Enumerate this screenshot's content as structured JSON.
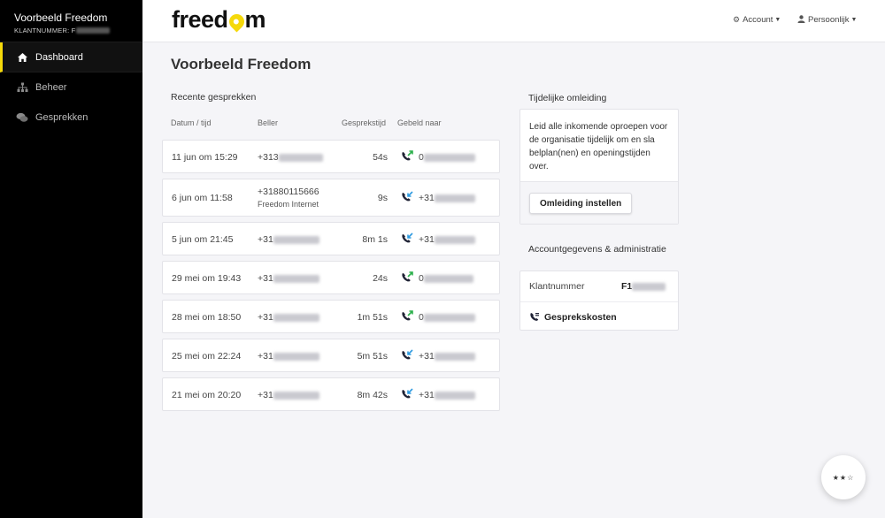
{
  "sidebar": {
    "org_name": "Voorbeeld Freedom",
    "customer_label": "KLANTNUMMER: F",
    "items": [
      {
        "label": "Dashboard",
        "icon": "home-icon",
        "active": true
      },
      {
        "label": "Beheer",
        "icon": "sitemap-icon",
        "active": false
      },
      {
        "label": "Gesprekken",
        "icon": "chat-icon",
        "active": false
      }
    ]
  },
  "header": {
    "logo_text_1": "freed",
    "logo_text_2": "m",
    "menus": [
      {
        "label": "Account",
        "icon": "gear-icon"
      },
      {
        "label": "Persoonlijk",
        "icon": "user-icon"
      }
    ]
  },
  "main": {
    "title": "Voorbeeld Freedom",
    "recent_calls": {
      "title": "Recente gesprekken",
      "columns": [
        "Datum / tijd",
        "Beller",
        "Gesprekstijd",
        "Gebeld naar"
      ],
      "rows": [
        {
          "date": "11 jun om 15:29",
          "caller": "+313",
          "caller_sub": "",
          "duration": "54s",
          "direction": "outgoing",
          "dest": "0"
        },
        {
          "date": "6 jun om 11:58",
          "caller": "+31880115666",
          "caller_sub": "Freedom Internet",
          "duration": "9s",
          "direction": "incoming",
          "dest": "+31"
        },
        {
          "date": "5 jun om 21:45",
          "caller": "+31",
          "caller_sub": "",
          "duration": "8m 1s",
          "direction": "incoming",
          "dest": "+31"
        },
        {
          "date": "29 mei om 19:43",
          "caller": "+31",
          "caller_sub": "",
          "duration": "24s",
          "direction": "outgoing",
          "dest": "0"
        },
        {
          "date": "28 mei om 18:50",
          "caller": "+31",
          "caller_sub": "",
          "duration": "1m 51s",
          "direction": "outgoing",
          "dest": "0"
        },
        {
          "date": "25 mei om 22:24",
          "caller": "+31",
          "caller_sub": "",
          "duration": "5m 51s",
          "direction": "incoming",
          "dest": "+31"
        },
        {
          "date": "21 mei om 20:20",
          "caller": "+31",
          "caller_sub": "",
          "duration": "8m 42s",
          "direction": "incoming",
          "dest": "+31"
        }
      ]
    },
    "redirect": {
      "title": "Tijdelijke omleiding",
      "text": "Leid alle inkomende oproepen voor de organisatie tijdelijk om en sla belplan(nen) en openingstijden over.",
      "button": "Omleiding instellen"
    },
    "account": {
      "title": "Accountgegevens & administratie",
      "customer_number_label": "Klantnummer",
      "customer_number_value": "F1",
      "costs_link": "Gesprekskosten"
    }
  },
  "colors": {
    "accent": "#f5d90a",
    "outgoing": "#2bb04b",
    "incoming": "#2f9be0",
    "sidebar_bg": "#000000"
  }
}
